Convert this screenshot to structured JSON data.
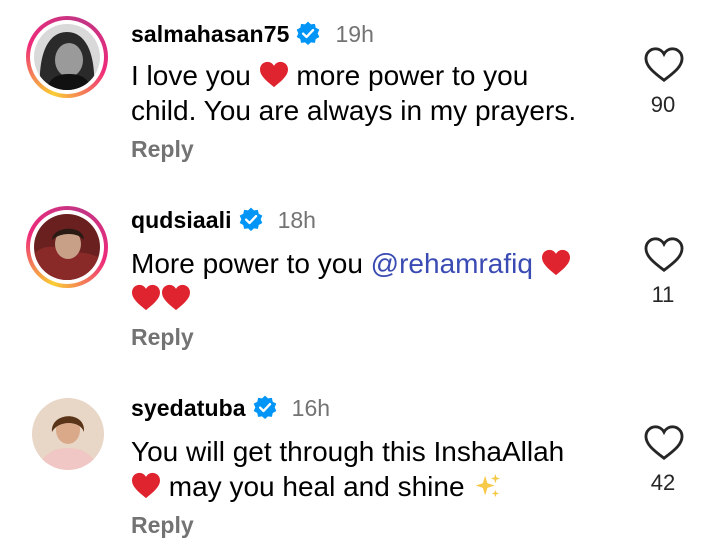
{
  "comments": [
    {
      "username": "salmahasan75",
      "time": "19h",
      "line1_a": "I love you",
      "line1_b": "more power to you",
      "line2": "child. You are always in my prayers.",
      "reply": "Reply",
      "likes": "90"
    },
    {
      "username": "qudsiaali",
      "time": "18h",
      "line1_a": "More power to you",
      "mention": "@rehamrafiq",
      "reply": "Reply",
      "likes": "11"
    },
    {
      "username": "syedatuba",
      "time": "16h",
      "line1": "You will get through this InshaAllah",
      "line2": "may you heal and shine",
      "reply": "Reply",
      "likes": "42"
    }
  ],
  "colors": {
    "heart": "#e0242f",
    "verified": "#0095f6",
    "mention": "#3a4bb3",
    "muted": "#737373"
  },
  "icons": [
    "verified-badge-icon",
    "heart-emoji",
    "like-heart-icon",
    "sparkles-emoji"
  ]
}
